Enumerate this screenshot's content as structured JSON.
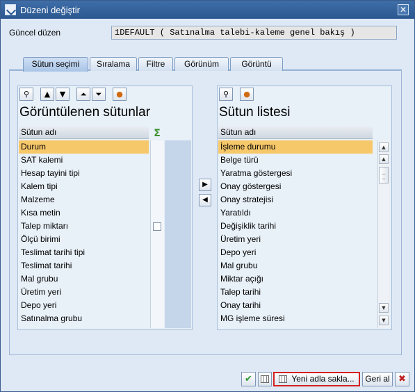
{
  "window": {
    "title": "Düzeni değiştir",
    "close_glyph": "✕"
  },
  "layout": {
    "label": "Güncel düzen",
    "value": "1DEFAULT ( Satınalma talebi-kaleme genel bakış )"
  },
  "tabs": [
    {
      "label": "Sütun seçimi",
      "active": true
    },
    {
      "label": "Sıralama",
      "active": false
    },
    {
      "label": "Filtre",
      "active": false
    },
    {
      "label": "Görünüm",
      "active": false
    },
    {
      "label": "Görüntü",
      "active": false
    }
  ],
  "left_list": {
    "title": "Görüntülenen sütunlar",
    "column_header": "Sütun adı",
    "sum_icon": "Σ",
    "toolbar_icons": [
      "binoculars-icon",
      "move-up-icon",
      "move-down-icon",
      "move-top-icon",
      "move-bottom-icon",
      "color-palette-icon"
    ],
    "rows": [
      "Durum",
      "SAT kalemi",
      "Hesap tayini tipi",
      "Kalem tipi",
      "Malzeme",
      "Kısa metin",
      "Talep miktarı",
      "Ölçü birimi",
      "Teslimat tarihi tipi",
      "Teslimat tarihi",
      "Mal grubu",
      "Üretim yeri",
      "Depo yeri",
      "Satınalma grubu"
    ],
    "selected_index": 0,
    "checkbox_row_index": 6
  },
  "movers": {
    "to_left_glyph": "◀",
    "to_right_glyph": "▶"
  },
  "right_list": {
    "title": "Sütun listesi",
    "column_header": "Sütun adı",
    "toolbar_icons": [
      "binoculars-icon",
      "color-palette-icon"
    ],
    "rows": [
      "İşleme durumu",
      "Belge türü",
      "Yaratma göstergesi",
      "Onay göstergesi",
      "Onay stratejisi",
      "Yaratıldı",
      "Değişiklik tarihi",
      "Üretim yeri",
      "Depo yeri",
      "Mal grubu",
      "Miktar açığı",
      "Talep tarihi",
      "Onay tarihi",
      "MG işleme süresi"
    ],
    "selected_index": 0
  },
  "footer": {
    "save_as_label": "Yeni adla sakla...",
    "back_label": "Geri al"
  }
}
